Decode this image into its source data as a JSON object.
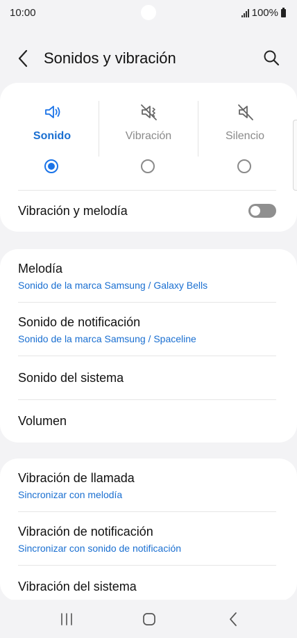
{
  "status_bar": {
    "time": "10:00",
    "battery": "100%"
  },
  "header": {
    "title": "Sonidos y vibración"
  },
  "sound_modes": [
    {
      "label": "Sonido",
      "selected": true
    },
    {
      "label": "Vibración",
      "selected": false
    },
    {
      "label": "Silencio",
      "selected": false
    }
  ],
  "vibrate_while_ringing": {
    "label": "Vibración y melodía",
    "enabled": false
  },
  "sound_settings": [
    {
      "title": "Melodía",
      "subtitle": "Sonido de la marca Samsung / Galaxy Bells"
    },
    {
      "title": "Sonido de notificación",
      "subtitle": "Sonido de la marca Samsung / Spaceline"
    },
    {
      "title": "Sonido del sistema"
    },
    {
      "title": "Volumen"
    }
  ],
  "vibration_settings": [
    {
      "title": "Vibración de llamada",
      "subtitle": "Sincronizar con melodía"
    },
    {
      "title": "Vibración de notificación",
      "subtitle": "Sincronizar con sonido de notificación"
    },
    {
      "title": "Vibración del sistema"
    }
  ],
  "colors": {
    "accent": "#1a73e8",
    "accent_text": "#1a6fd1",
    "background": "#f3f3f5",
    "card": "#ffffff"
  },
  "icons": {
    "back": "chevron-left-icon",
    "search": "search-icon",
    "sound": "speaker-icon",
    "vibrate": "vibrate-icon",
    "mute": "mute-icon",
    "nav_recents": "recents-icon",
    "nav_home": "home-icon",
    "nav_back": "back-icon"
  }
}
